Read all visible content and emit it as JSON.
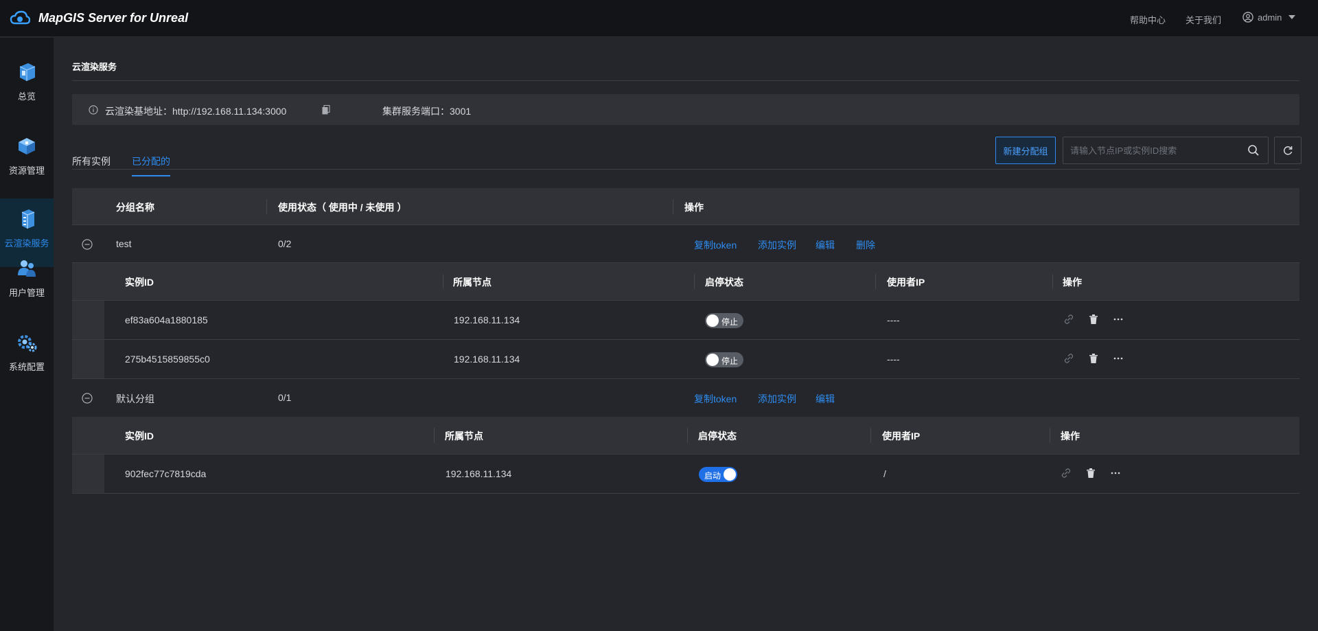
{
  "app": {
    "title": "MapGIS Server for Unreal"
  },
  "header": {
    "help_label": "帮助中心",
    "about_label": "关于我们",
    "user_name": "admin"
  },
  "sidebar": {
    "items": [
      {
        "label": "总览",
        "icon": "overview-icon"
      },
      {
        "label": "资源管理",
        "icon": "resource-icon"
      },
      {
        "label": "云渲染服务",
        "icon": "cloud-render-icon",
        "active": true
      },
      {
        "label": "用户管理",
        "icon": "user-manage-icon"
      },
      {
        "label": "系统配置",
        "icon": "system-config-icon"
      }
    ]
  },
  "page": {
    "title": "云渲染服务"
  },
  "info": {
    "base_address": "云渲染基地址：http://192.168.11.134:3000",
    "cluster_port": "集群服务端口：3001"
  },
  "tabs": [
    {
      "label": "所有实例"
    },
    {
      "label": "已分配的",
      "active": true
    }
  ],
  "toolbar": {
    "new_group_label": "新建分配组",
    "search_placeholder": "请输入节点IP或实例ID搜索"
  },
  "table": {
    "headers": [
      "分组名称",
      "使用状态（ 使用中 / 未使用 ）",
      "操作"
    ],
    "sub_headers": [
      "实例ID",
      "所属节点",
      "启停状态",
      "使用者IP",
      "操作"
    ],
    "groups": [
      {
        "name": "test",
        "usage": "0/2",
        "actions": [
          "复制token",
          "添加实例",
          "编辑",
          "删除"
        ],
        "instances": [
          {
            "id": "ef83a604a1880185",
            "node": "192.168.11.134",
            "state_label": "停止",
            "on": false,
            "user_ip": "----"
          },
          {
            "id": "275b4515859855c0",
            "node": "192.168.11.134",
            "state_label": "停止",
            "on": false,
            "user_ip": "----"
          }
        ]
      },
      {
        "name": "默认分组",
        "usage": "0/1",
        "actions": [
          "复制token",
          "添加实例",
          "编辑"
        ],
        "instances": [
          {
            "id": "902fec77c7819cda",
            "node": "192.168.11.134",
            "state_label": "启动",
            "on": true,
            "user_ip": "/"
          }
        ]
      }
    ]
  },
  "colors": {
    "accent": "#2e8cf0",
    "background": "#24262b",
    "topbar": "#131417",
    "sidebar": "#17181b"
  }
}
